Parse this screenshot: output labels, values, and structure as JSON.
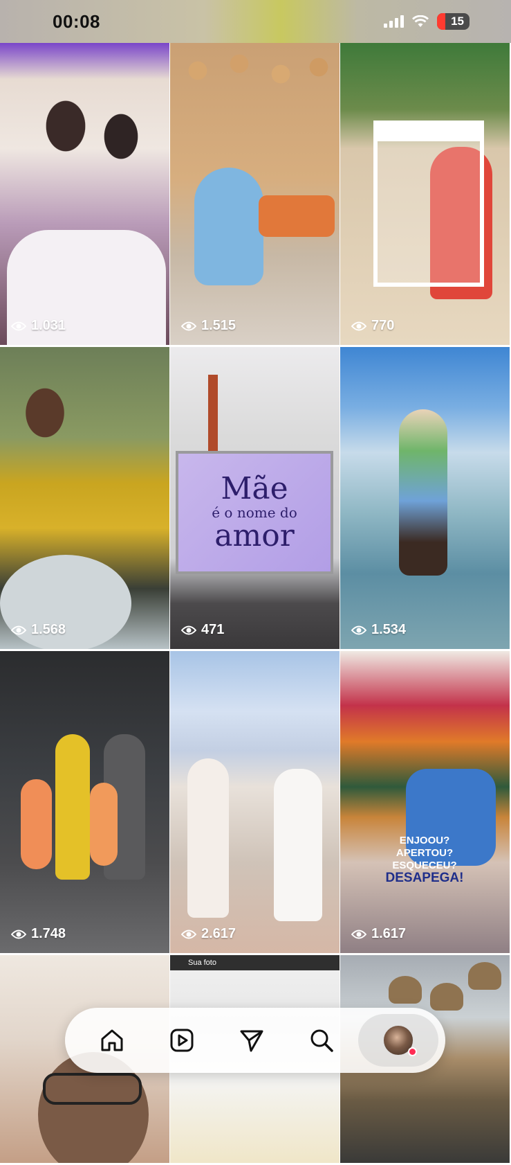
{
  "status_bar": {
    "time": "00:08",
    "battery": "15"
  },
  "grid": {
    "tiles": [
      {
        "views": "1.031",
        "description": "party-couple"
      },
      {
        "views": "1.515",
        "description": "girl-teddy-bears-birthday"
      },
      {
        "views": "770",
        "description": "beach-photo-frame"
      },
      {
        "views": "1.568",
        "description": "woman-yellow-dress-toast"
      },
      {
        "views": "471",
        "description": "mae-event-screen"
      },
      {
        "views": "1.534",
        "description": "glass-floor-cruise"
      },
      {
        "views": "1.748",
        "description": "family-elevator"
      },
      {
        "views": "2.617",
        "description": "family-stage-white"
      },
      {
        "views": "1.617",
        "description": "clothes-desapega"
      },
      {
        "views": "",
        "description": "selfie-glasses"
      },
      {
        "views": "",
        "description": "screenshot-photo"
      },
      {
        "views": "",
        "description": "restaurant-lamps"
      }
    ],
    "screen_text": {
      "line1": "Mãe",
      "line2": "é o nome do",
      "line3": "amor"
    },
    "promo_text": {
      "line1": "ENJOOU?",
      "line2": "APERTOU?",
      "line3": "ESQUECEU?",
      "line4": "DESAPEGA!"
    },
    "photo_bar_label": "Sua foto"
  },
  "nav": {
    "items": [
      {
        "icon": "home-icon"
      },
      {
        "icon": "reels-icon"
      },
      {
        "icon": "send-icon"
      },
      {
        "icon": "search-icon"
      },
      {
        "icon": "profile-avatar"
      }
    ]
  },
  "colors": {
    "notification_dot": "#ff2d55",
    "battery_low": "#ff3b30"
  }
}
